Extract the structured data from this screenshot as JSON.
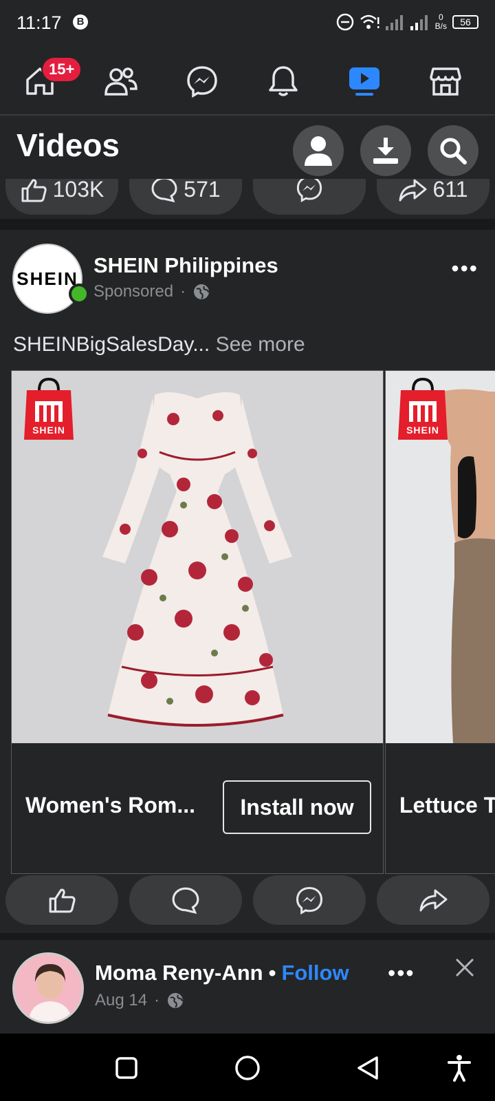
{
  "status_bar": {
    "time": "11:17",
    "b_badge": "B",
    "net_speed_top": "0",
    "net_speed_bottom": "B/s",
    "battery": "56"
  },
  "top_nav": {
    "home_badge": "15+",
    "items": [
      "home-icon",
      "friends-icon",
      "messenger-icon",
      "notifications-icon",
      "video-icon",
      "marketplace-icon"
    ],
    "active": "video-icon",
    "accent": "#2d88ff"
  },
  "header": {
    "title": "Videos"
  },
  "prev_post_reactions": {
    "likes": "103K",
    "comments": "571",
    "shares": "611"
  },
  "post": {
    "author": "SHEIN Philippines",
    "avatar_text": "SHEIN",
    "meta": "Sponsored",
    "text": "SHEINBigSalesDay...",
    "see_more": "See more",
    "cards": [
      {
        "title": "Women's Rom...",
        "cta": "Install now",
        "logo_text": "SHEIN"
      },
      {
        "title": "Lettuce T",
        "logo_text": "SHEIN"
      }
    ]
  },
  "next_post": {
    "author": "Moma Reny-Ann",
    "follow": "Follow",
    "date": "Aug 14"
  }
}
